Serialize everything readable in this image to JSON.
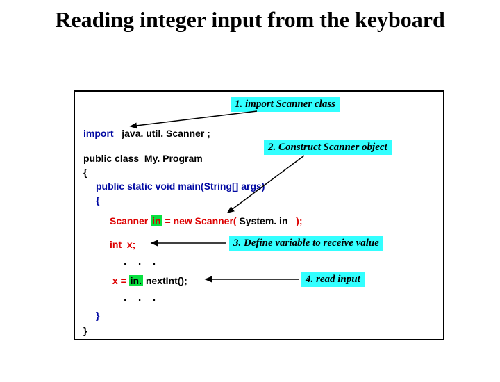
{
  "title": "Reading integer input from the keyboard",
  "annotations": {
    "a1": "1. import  Scanner class",
    "a2": "2. Construct Scanner object",
    "a3": "3. Define variable to receive value",
    "a4": "4. read input"
  },
  "code": {
    "import_kw": "import",
    "import_pkg": "   java. util. Scanner ;",
    "class_decl": "public class  My. Program",
    "open_brace": "{",
    "main_sig": "public static void main(String[] args)",
    "open_brace2": "{",
    "scanner_pre": "Scanner ",
    "scanner_in1": "in",
    "scanner_mid": " = new Scanner( ",
    "scanner_sysin": "System. in",
    "scanner_post": "   );",
    "intx": "int  x;",
    "assign_pre": " x = ",
    "assign_in": "in.",
    "assign_post": " nextInt();",
    "close_brace2": "}",
    "close_brace": "}",
    "dots": ". . ."
  }
}
